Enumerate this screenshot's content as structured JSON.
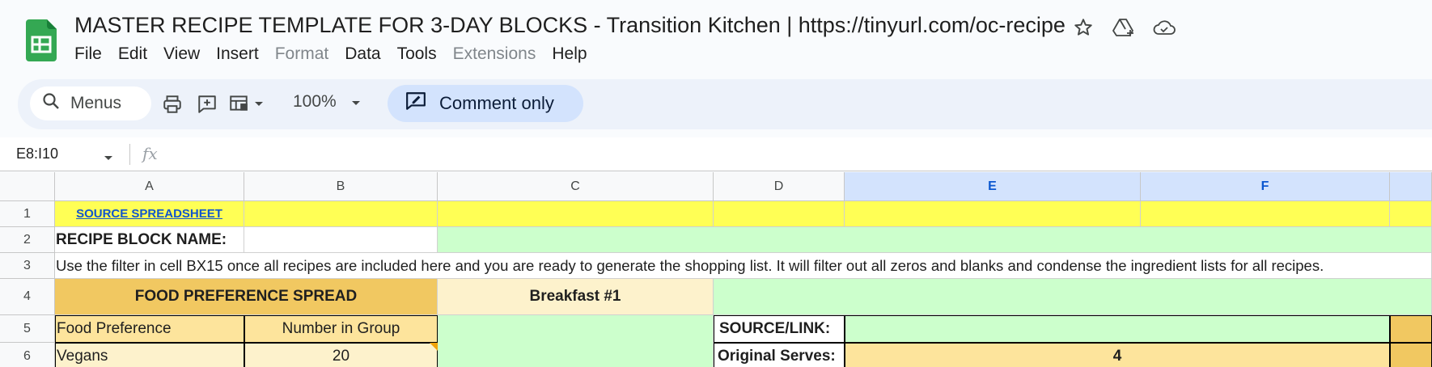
{
  "app": {
    "title": "MASTER RECIPE TEMPLATE FOR 3-DAY BLOCKS - Transition Kitchen | https://tinyurl.com/oc-recipe",
    "logo": "google-sheets-icon",
    "title_icons": [
      "star-icon",
      "move-to-drive-icon",
      "cloud-status-icon"
    ]
  },
  "menu": {
    "items": [
      {
        "label": "File",
        "disabled": false
      },
      {
        "label": "Edit",
        "disabled": false
      },
      {
        "label": "View",
        "disabled": false
      },
      {
        "label": "Insert",
        "disabled": false
      },
      {
        "label": "Format",
        "disabled": true
      },
      {
        "label": "Data",
        "disabled": false
      },
      {
        "label": "Tools",
        "disabled": false
      },
      {
        "label": "Extensions",
        "disabled": true
      },
      {
        "label": "Help",
        "disabled": false
      }
    ]
  },
  "toolbar": {
    "search_placeholder": "Menus",
    "zoom": "100%",
    "comment_only": "Comment only",
    "icons": [
      "search-icon",
      "print-icon",
      "add-comment-icon",
      "select-format-icon",
      "dropdown-icon",
      "comment-only-icon"
    ]
  },
  "formula_bar": {
    "name_box": "E8:I10",
    "fx": "fx",
    "value": ""
  },
  "grid": {
    "columns": [
      "A",
      "B",
      "C",
      "D",
      "E",
      "F",
      ""
    ],
    "selected_columns": [
      "E",
      "F"
    ],
    "rows": [
      "1",
      "2",
      "3",
      "4",
      "5",
      "6"
    ],
    "cells": {
      "A1": "SOURCE SPREADSHEET",
      "A2": "RECIPE BLOCK NAME:",
      "A3": "Use the filter in cell BX15 once all recipes are included here and you are ready to generate the shopping list. It will filter out all zeros and blanks and condense the ingredient lists for all recipes.",
      "A4": "FOOD PREFERENCE SPREAD",
      "C4": "Breakfast #1",
      "A5": "Food Preference",
      "B5": "Number in Group",
      "D5": "SOURCE/LINK:",
      "A6": "Vegans",
      "B6": "20",
      "D6": "Original Serves:",
      "E6": "4"
    },
    "colors": {
      "yellow": "#ffff55",
      "green": "#ccffcc",
      "gold": "#f1c861",
      "cream": "#fdf2cc",
      "tan": "#fde49c",
      "selected_header": "#d3e3fd",
      "link": "#1155cc"
    }
  }
}
